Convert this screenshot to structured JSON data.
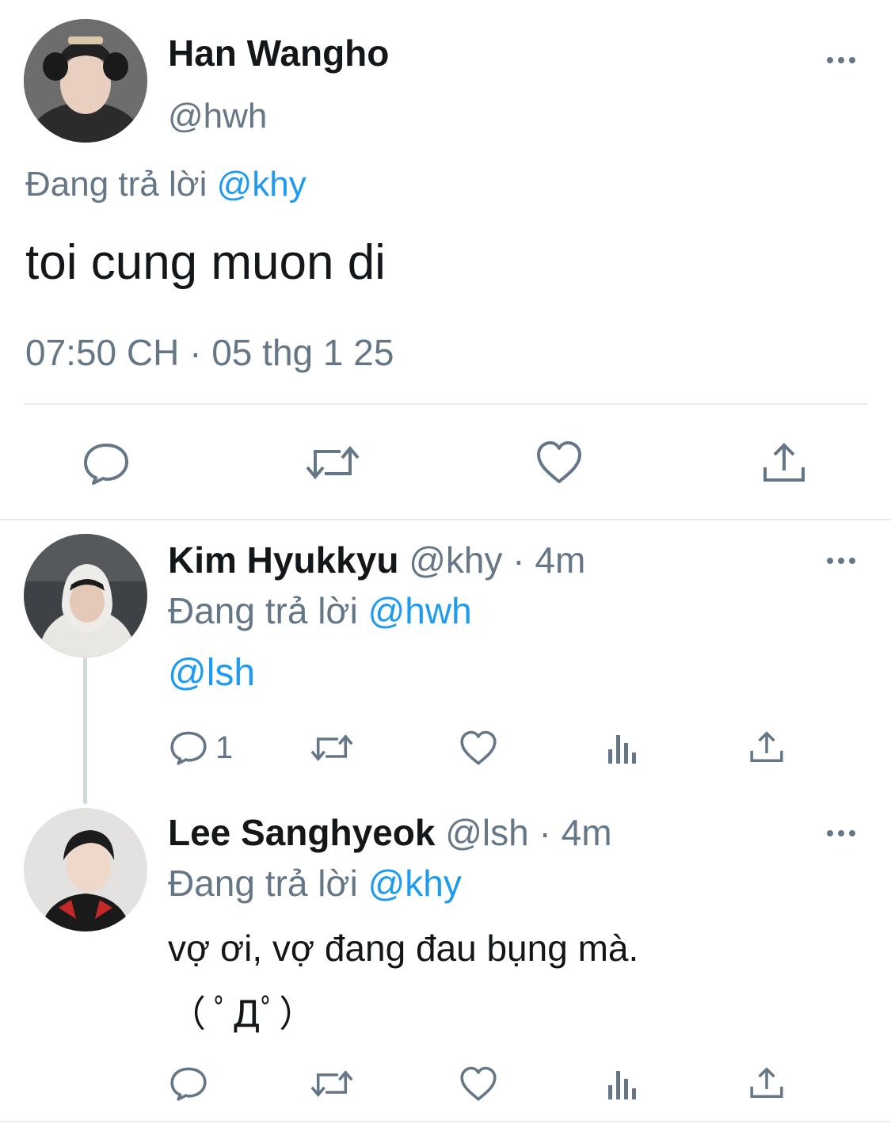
{
  "main_tweet": {
    "author_name": "Han Wangho",
    "handle": "@hwh",
    "replying_prefix": "Đang trả lời",
    "replying_to": "@khy",
    "text": "toi cung muon di",
    "timestamp": "07:50 CH · 05 thg 1 25",
    "more_icon": "more-dots-icon",
    "actions": [
      "reply-icon",
      "retweet-icon",
      "like-icon",
      "share-icon"
    ]
  },
  "replies": [
    {
      "author_name": "Kim Hyukkyu",
      "handle_time": "@khy · 4m",
      "replying_prefix": "Đang trả lời",
      "replying_to": "@hwh",
      "text": "@lsh",
      "reply_count": "1"
    },
    {
      "author_name": "Lee Sanghyeok",
      "handle_time": "@lsh · 4m",
      "replying_prefix": "Đang trả lời",
      "replying_to": "@khy",
      "text_line1": "vợ ơi, vợ đang đau bụng mà.",
      "text_line2": "（ ﾟДﾟ）"
    }
  ],
  "colors": {
    "text": "#14171a",
    "secondary": "#657786",
    "accent": "#1d9bf0",
    "divider": "#e6ecf0"
  }
}
